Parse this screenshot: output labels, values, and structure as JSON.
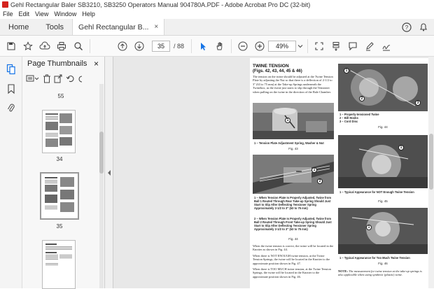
{
  "window": {
    "title": "Gehl Rectangular Baler SB3210, SB3250 Operators Manual 904780A.PDF - Adobe Acrobat Pro DC (32-bit)"
  },
  "menu": [
    "File",
    "Edit",
    "View",
    "Window",
    "Help"
  ],
  "tabs": {
    "home": "Home",
    "tools": "Tools",
    "document": "Gehl Rectangular B...",
    "close": "×"
  },
  "toolbar": {
    "current_page": "35",
    "page_count": "/ 88",
    "zoom": "49%"
  },
  "panel": {
    "title": "Page Thumbnails",
    "close": "×",
    "thumbnails": [
      {
        "label": "55"
      },
      {
        "label": "34"
      },
      {
        "label": "35"
      },
      {
        "label": ""
      }
    ]
  },
  "page": {
    "heading": "TWINE TENSION",
    "subheading": "(Figs. 42, 43, 44, 45 & 46)",
    "intro": "The tension on the twine should be adjusted at the Twine Tension Plate by adjusting the Nut so that there is a deflection of 2-1/2 to 3\" (63 to 75 mm) at the Take-up Springs underneath the Twinebox, as the twine just starts to slip through the Tensioner when pulling on the twine in the direction of the Bale Chamber.",
    "fig43_caption": "1 – Tension Plate Adjustment Spring, Washer & Nut",
    "fig43": "Fig. 43",
    "fig44b_captions": [
      "1 – When Tension Plate Is Properly Adjusted, Twine from Ball 1 Routed Through Rear Take-up Spring Should Just Start to Slip After Deflecting Tensioner Spring Approximately 2-1/2 to 3\" (63 to 75 mm)",
      "2 – When Tension Plate Is Properly Adjusted, Twine from Ball 2 Routed Through Front Take-up Spring Should Just Start to Slip After Deflecting Tensioner Spring Approximately 2-1/2 to 3\" (63 to 75 mm)"
    ],
    "fig44b": "Fig. 44",
    "para1": "When the twine tension is correct, the twine will be located in the Knotter as shown in Fig. 44.",
    "para2": "When there is NOT ENOUGH twine tension, at the Twine Tension Springs, the twine will be located in the Knotter to the approximate position shown in Fig. 47.",
    "para3": "When there is TOO MUCH twine tension, at the Twine Tension Springs, the twine will be located in the Knotter to the approximate position shown in Fig. 46.",
    "fig_r1_captions": [
      "1 – Properly-tensioned Twine",
      "2 – Bill Hooks",
      "3 – Cord Disc"
    ],
    "fig_r1": "Fig. 44",
    "fig_r2_caption": "1 – Typical Appearance for NOT Enough Twine Tension",
    "fig_r2": "Fig. 45",
    "fig_r3_caption": "1 – Typical Appearance for Too Much Twine Tension",
    "fig_r3": "Fig. 46",
    "note_label": "NOTE:",
    "note_text": "The measurement for twine tension at the take-up springs is also applicable when using synthetic (plastic) twine."
  },
  "colors": {
    "accent": "#d4231e",
    "link_blue": "#1473e6"
  }
}
